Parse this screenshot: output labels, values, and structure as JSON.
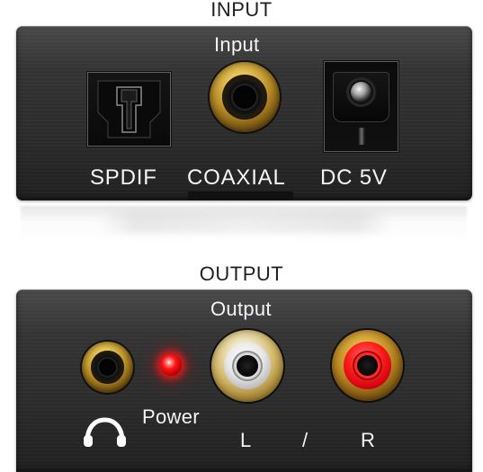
{
  "input_section": {
    "heading": "INPUT",
    "panel_label": "Input",
    "ports": [
      {
        "label": "SPDIF",
        "icon": "spdif-optical-port-icon"
      },
      {
        "label": "COAXIAL",
        "icon": "coaxial-port-icon"
      },
      {
        "label": "DC 5V",
        "icon": "dc-power-jack-icon"
      }
    ]
  },
  "output_section": {
    "heading": "OUTPUT",
    "panel_label": "Output",
    "power_label": "Power",
    "left_label": "L",
    "separator": "/",
    "right_label": "R",
    "icons": {
      "headphone": "headphone-icon",
      "power_led": "power-led-icon",
      "left_rca": "left-rca-port-icon",
      "right_rca": "right-rca-port-icon"
    }
  },
  "colors": {
    "panel": "#2f2f30",
    "label_text": "#f4f4f4",
    "heading_text": "#1f1f1f",
    "gold": "#c59b31",
    "red": "#ff1d1d",
    "white": "#f0f0f0"
  }
}
